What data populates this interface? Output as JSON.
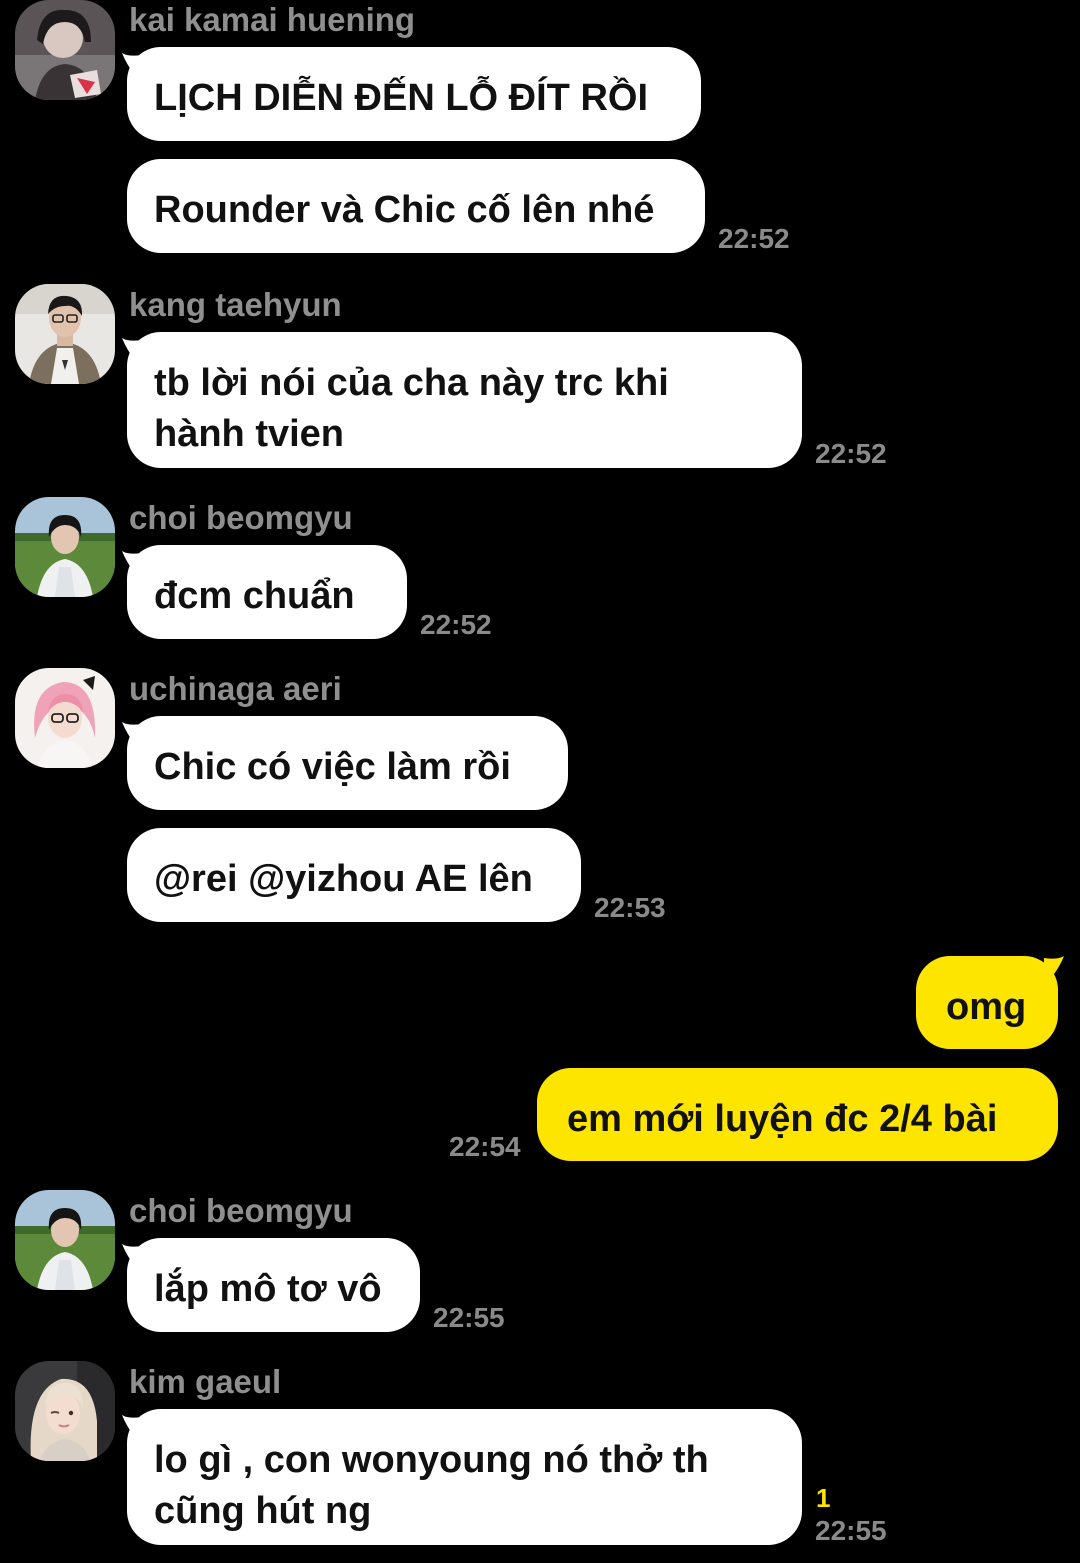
{
  "conversation": {
    "messages": [
      {
        "sender": "kai kamai huening",
        "text": "LỊCH DIỄN ĐẾN LỖ ĐÍT RỒI"
      },
      {
        "text": "Rounder và Chic cố lên nhé",
        "time": "22:52"
      },
      {
        "sender": "kang taehyun",
        "lines": [
          "tb lời nói của cha này trc khi",
          "hành tvien"
        ],
        "time": "22:52"
      },
      {
        "sender": "choi beomgyu",
        "text": "đcm chuẩn",
        "time": "22:52"
      },
      {
        "sender": "uchinaga aeri",
        "text": "Chic có việc làm rồi"
      },
      {
        "text": "@rei @yizhou AE lên",
        "time": "22:53"
      },
      {
        "outgoing": true,
        "text": "omg"
      },
      {
        "outgoing": true,
        "text": "em mới luyện đc 2/4 bài",
        "time": "22:54"
      },
      {
        "sender": "choi beomgyu",
        "text": "lắp mô tơ vô",
        "time": "22:55"
      },
      {
        "sender": "kim gaeul",
        "lines": [
          "lo gì , con wonyoung nó thở th",
          "cũng hút ng"
        ],
        "time": "22:55",
        "unread": "1"
      }
    ]
  },
  "icons": {
    "avatars": [
      "avatar-kai-icon",
      "avatar-taehyun-icon",
      "avatar-beomgyu-icon",
      "avatar-aeri-icon",
      "avatar-beomgyu-icon",
      "avatar-gaeul-icon"
    ]
  },
  "colors": {
    "background": "#000000",
    "incoming_bubble": "#ffffff",
    "outgoing_bubble": "#fee500",
    "sender_name": "#8f8f8f",
    "timestamp": "#8a8a8a",
    "unread_count": "#fee500"
  }
}
